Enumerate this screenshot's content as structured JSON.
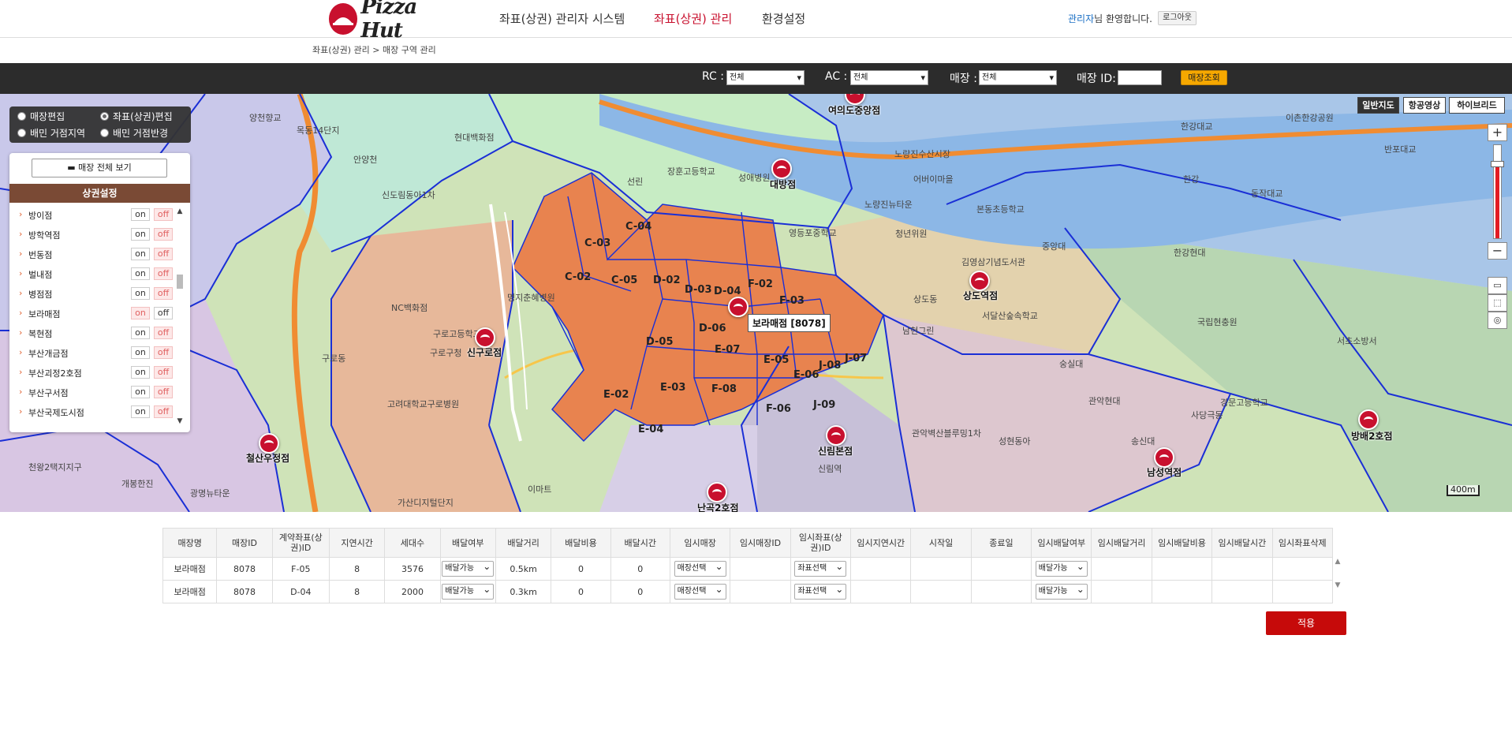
{
  "header": {
    "logo_text": "Pizza Hut",
    "nav": [
      "좌표(상권) 관리자 시스템",
      "좌표(상권) 관리",
      "환경설정"
    ],
    "welcome_user": "관리자",
    "welcome_suffix": "님 환영합니다.",
    "logout_label": "로그아웃"
  },
  "breadcrumb": "좌표(상권) 관리 > 매장 구역 관리",
  "filters": {
    "rc_label": "RC :",
    "rc_value": "전체",
    "ac_label": "AC :",
    "ac_value": "전체",
    "store_label": "매장 :",
    "store_value": "전체",
    "store_id_label": "매장 ID:",
    "store_id_value": "",
    "search_label": "매장조회"
  },
  "map": {
    "map_types": [
      "일반지도",
      "항공영상",
      "하이브리드"
    ],
    "active_map_type": "일반지도",
    "scale_label": "400m",
    "tooltip": "보라매점 [8078]",
    "zone_labels": [
      "C-03",
      "C-04",
      "C-02",
      "C-05",
      "D-02",
      "D-03",
      "D-04",
      "F-02",
      "F-03",
      "D-06",
      "D-05",
      "E-07",
      "E-05",
      "J-07",
      "J-08",
      "E-02",
      "E-03",
      "F-08",
      "F-06",
      "J-09",
      "E-04",
      "E-06"
    ],
    "stores": [
      "대방점",
      "여의도중앙점",
      "상도역점",
      "신구로점",
      "신림본점",
      "철산우정점",
      "난곡2호점",
      "남성역점",
      "방배2호점"
    ],
    "places": [
      "양천향교",
      "목동14단지",
      "안양천",
      "신도림동아1차",
      "선린",
      "장훈고등학교",
      "성애병원",
      "노량진수산시장",
      "어버이마을",
      "한강대교",
      "이촌한강공원",
      "반포대교",
      "한강",
      "동작대교",
      "본동초등학교",
      "노량진뉴타운",
      "영등포중학교",
      "청년위원",
      "김영삼기념도서관",
      "중앙대",
      "한강현대",
      "명지춘혜병원",
      "NC백화점",
      "구로고등학교",
      "구로구청",
      "고려대학교구로병원",
      "상도동",
      "남현그린",
      "숭실대",
      "관악현대",
      "사당극동",
      "신림역",
      "관악벽산블루밍1차",
      "성현동아",
      "가산디지털단지",
      "이마트",
      "현대백화점",
      "서초소방서",
      "국립현충원",
      "서달산숲속학교",
      "경문고등학교",
      "송신대",
      "광명뉴타운",
      "개봉한진",
      "천왕2택지지구",
      "구로동"
    ],
    "radio_options": [
      {
        "label": "매장편집",
        "checked": false
      },
      {
        "label": "좌표(상권)편집",
        "checked": true
      },
      {
        "label": "배민 거점지역",
        "checked": false
      },
      {
        "label": "배민 거점반경",
        "checked": false
      }
    ]
  },
  "side_panel": {
    "view_all_label": "매장 전체 보기",
    "section_title": "상권설정",
    "on_label": "on",
    "off_label": "off",
    "areas": [
      {
        "name": "방이점",
        "state": "on"
      },
      {
        "name": "방학역점",
        "state": "on"
      },
      {
        "name": "번동점",
        "state": "on"
      },
      {
        "name": "벌내점",
        "state": "on"
      },
      {
        "name": "병점점",
        "state": "on"
      },
      {
        "name": "보라매점",
        "state": "off"
      },
      {
        "name": "복현점",
        "state": "on"
      },
      {
        "name": "부산개금점",
        "state": "on"
      },
      {
        "name": "부산괴정2호점",
        "state": "on"
      },
      {
        "name": "부산구서점",
        "state": "on"
      },
      {
        "name": "부산국제도시점",
        "state": "on"
      }
    ]
  },
  "table": {
    "headers": [
      "매장명",
      "매장ID",
      "계약좌표(상권)ID",
      "지연시간",
      "세대수",
      "배달여부",
      "배달거리",
      "배달비용",
      "배달시간",
      "임시매장",
      "임시매장ID",
      "임시좌표(상권)ID",
      "임시지연시간",
      "시작일",
      "종료일",
      "임시배달여부",
      "임시배달거리",
      "임시배달비용",
      "임시배달시간",
      "임시좌표삭제"
    ],
    "rows": [
      {
        "store": "보라매점",
        "id": "8078",
        "zone": "F-05",
        "delay": "8",
        "households": "3576",
        "delivery": "배달가능",
        "distance": "0.5km",
        "cost": "0",
        "time": "0",
        "temp_store": "매장선택",
        "temp_store_id": "",
        "temp_zone": "좌표선택",
        "temp_delay": "",
        "start": "",
        "end": "",
        "temp_delivery": "배달가능",
        "temp_distance": "",
        "temp_cost": "",
        "temp_time": "",
        "delete": ""
      },
      {
        "store": "보라매점",
        "id": "8078",
        "zone": "D-04",
        "delay": "8",
        "households": "2000",
        "delivery": "배달가능",
        "distance": "0.3km",
        "cost": "0",
        "time": "0",
        "temp_store": "매장선택",
        "temp_store_id": "",
        "temp_zone": "좌표선택",
        "temp_delay": "",
        "start": "",
        "end": "",
        "temp_delivery": "배달가능",
        "temp_distance": "",
        "temp_cost": "",
        "temp_time": "",
        "delete": ""
      }
    ],
    "apply_label": "적용"
  },
  "colors": {
    "brand_red": "#c8102e",
    "zone_fill": "#e8834f",
    "boundary": "#1a2fd6",
    "search_btn": "#f6a800",
    "apply_btn": "#c60a0a"
  }
}
